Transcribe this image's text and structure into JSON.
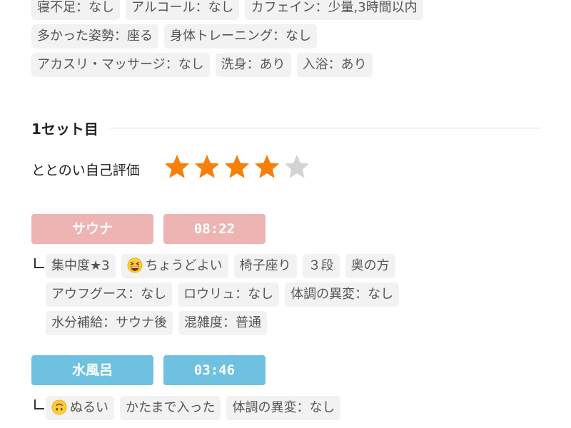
{
  "conditions": {
    "row1": [
      "寝不足：なし",
      "アルコール：なし",
      "カフェイン：少量,3時間以内"
    ],
    "row2": [
      "多かった姿勢：座る",
      "身体トレーニング：なし"
    ],
    "row3": [
      "アカスリ・マッサージ：なし",
      "洗身：あり",
      "入浴：あり"
    ]
  },
  "set": {
    "title": "1セット目",
    "rating_label": "ととのい自己評価",
    "rating": 4,
    "rating_max": 5
  },
  "sauna": {
    "label": "サウナ",
    "time": "08:22",
    "tags_row1": [
      "集中度★3",
      "ちょうどよい",
      "椅子座り",
      "３段",
      "奥の方"
    ],
    "tags_row2": [
      "アウフグース：なし",
      "ロウリュ：なし",
      "体調の異変：なし"
    ],
    "tags_row3": [
      "水分補給：サウナ後",
      "混雑度：普通"
    ]
  },
  "water": {
    "label": "水風呂",
    "time": "03:46",
    "tags_row1": [
      "ぬるい",
      "かたまで入った",
      "体調の異変：なし"
    ]
  },
  "colors": {
    "sauna": "#eeb3b3",
    "water": "#6ec1e0",
    "star_on": "#f77f0a",
    "star_off": "#d3d3d3"
  },
  "icons": {
    "sauna_emoji": "grinning-squinting-face-icon",
    "water_emoji": "upside-down-face-icon",
    "branch": "branch-icon",
    "star": "star-icon"
  }
}
